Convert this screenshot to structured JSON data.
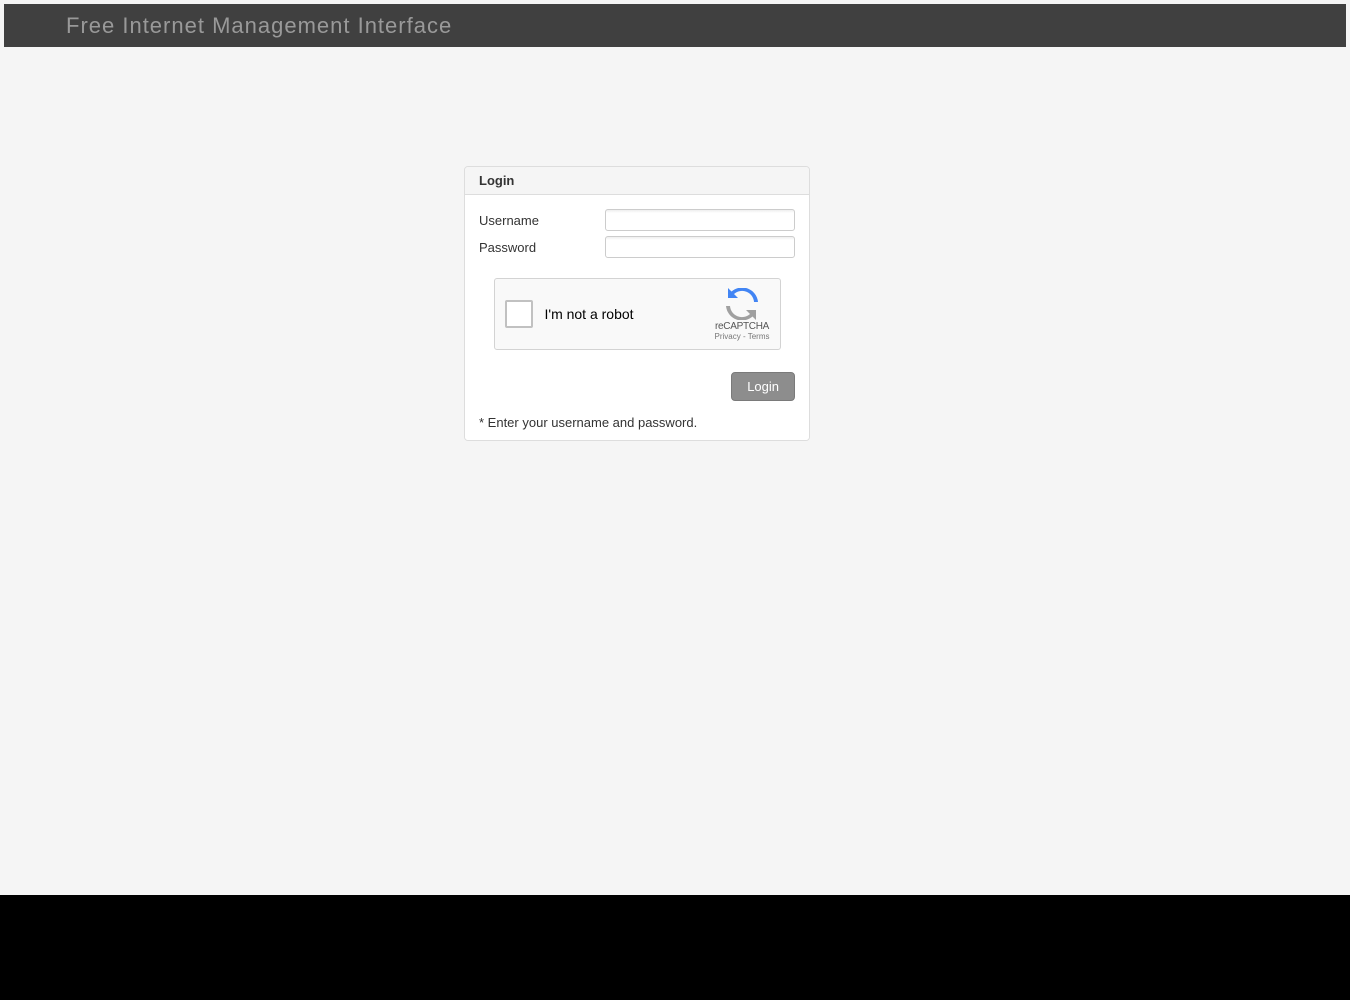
{
  "header": {
    "title": "Free Internet Management Interface"
  },
  "login": {
    "panel_title": "Login",
    "username_label": "Username",
    "username_value": "",
    "password_label": "Password",
    "password_value": "",
    "button_label": "Login",
    "footer_text": "* Enter your username and password."
  },
  "recaptcha": {
    "text": "I'm not a robot",
    "brand": "reCAPTCHA",
    "privacy": "Privacy",
    "terms": "Terms",
    "separator": " - "
  }
}
